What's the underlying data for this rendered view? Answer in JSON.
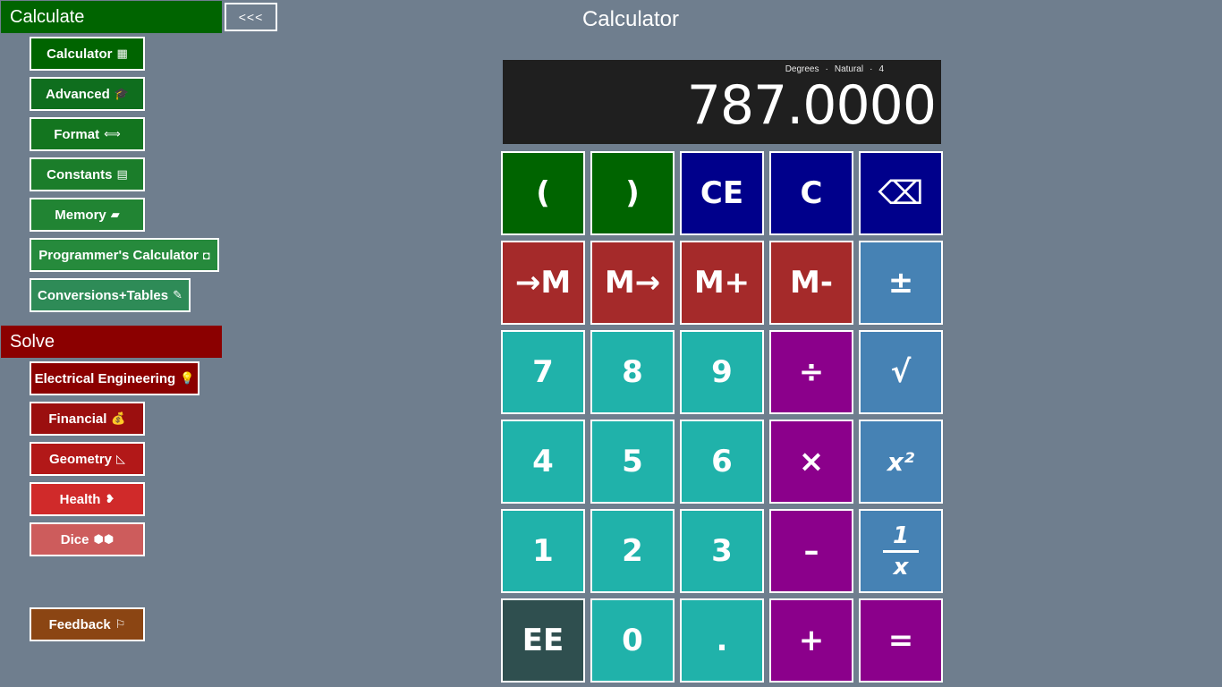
{
  "sidebar": {
    "calculate_header": "Calculate",
    "collapse_label": "<<<",
    "calculate_items": [
      {
        "label": "Calculator",
        "icon": "▦",
        "icon_name": "calculator-icon",
        "color": "#006400"
      },
      {
        "label": "Advanced",
        "icon": "🎓",
        "icon_name": "graduation-cap-icon",
        "color": "#0f6e1e"
      },
      {
        "label": "Format",
        "icon": "⟺",
        "icon_name": "arrows-horizontal-icon",
        "color": "#13751f"
      },
      {
        "label": "Constants",
        "icon": "▤",
        "icon_name": "list-icon",
        "color": "#1b7d2a"
      },
      {
        "label": "Memory",
        "icon": "▰",
        "icon_name": "memory-icon",
        "color": "#218433"
      },
      {
        "label": "Programmer's Calculator",
        "icon": "◘",
        "icon_name": "power-icon",
        "color": "#268a3c"
      },
      {
        "label": "Conversions+Tables",
        "icon": "✎",
        "icon_name": "pencil-icon",
        "color": "#2e8b57"
      }
    ],
    "solve_header": "Solve",
    "solve_items": [
      {
        "label": "Electrical Engineering",
        "icon": "💡",
        "icon_name": "lightbulb-icon",
        "color": "#8b0000"
      },
      {
        "label": "Financial",
        "icon": "💰",
        "icon_name": "money-bag-icon",
        "color": "#9b0f0f"
      },
      {
        "label": "Geometry",
        "icon": "◺",
        "icon_name": "triangle-ruler-icon",
        "color": "#b21818"
      },
      {
        "label": "Health",
        "icon": "❥",
        "icon_name": "health-icon",
        "color": "#d02a2a"
      },
      {
        "label": "Dice",
        "icon": "⬢⬢",
        "icon_name": "dice-icon",
        "color": "#cd5c5c"
      }
    ],
    "feedback": {
      "label": "Feedback",
      "icon": "⚐",
      "icon_name": "feedback-icon",
      "color": "#8b4513"
    }
  },
  "main": {
    "title": "Calculator",
    "display": {
      "angle_mode": "Degrees",
      "format_mode": "Natural",
      "precision": "4",
      "value": "787.0000"
    },
    "keys": [
      [
        "(",
        ")",
        "CE",
        "C",
        "⌫"
      ],
      [
        "→M",
        "M→",
        "M+",
        "M-",
        "±"
      ],
      [
        "7",
        "8",
        "9",
        "÷",
        "√"
      ],
      [
        "4",
        "5",
        "6",
        "×",
        "x²"
      ],
      [
        "1",
        "2",
        "3",
        "–",
        "1/x"
      ],
      [
        "EE",
        "0",
        ".",
        "+",
        "="
      ]
    ],
    "reciprocal_num": "1",
    "reciprocal_den": "x"
  }
}
